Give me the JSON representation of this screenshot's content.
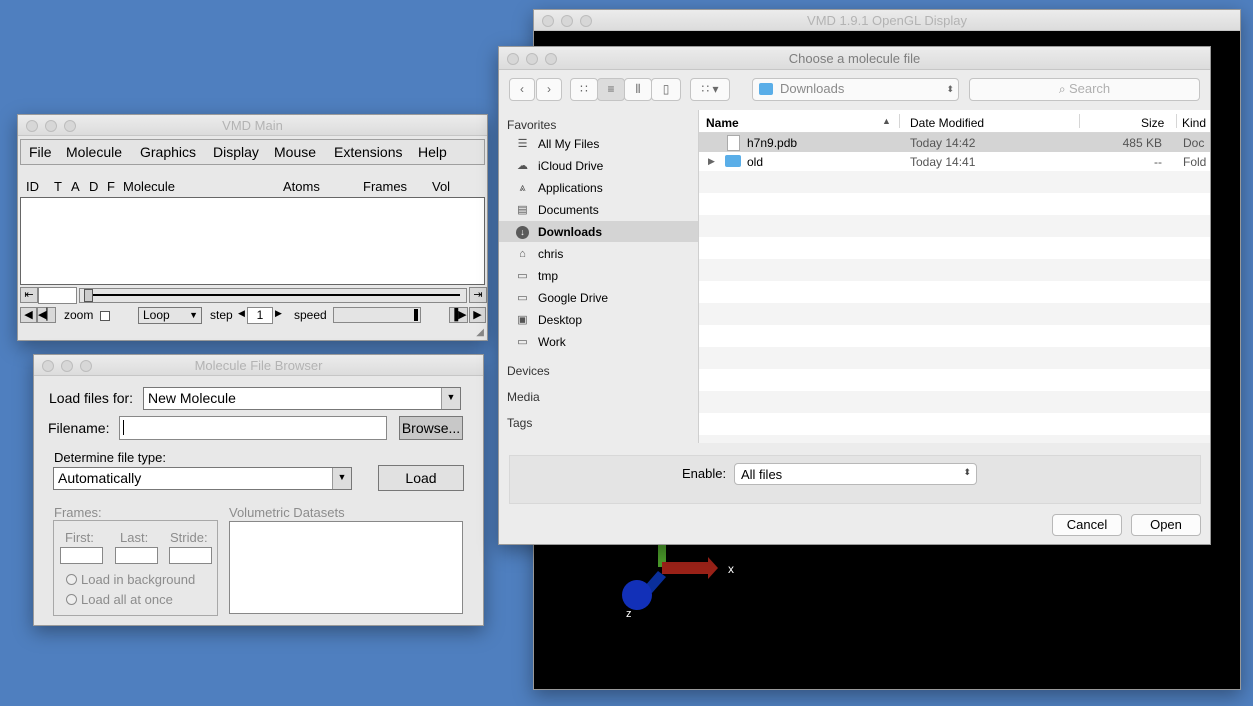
{
  "gl_window": {
    "title": "VMD 1.9.1 OpenGL Display",
    "axis_x": "x",
    "axis_z": "z"
  },
  "vmd_main": {
    "title": "VMD Main",
    "menus": [
      "File",
      "Molecule",
      "Graphics",
      "Display",
      "Mouse",
      "Extensions",
      "Help"
    ],
    "columns": [
      "ID",
      "T",
      "A",
      "D",
      "F",
      "Molecule",
      "Atoms",
      "Frames",
      "Vol"
    ],
    "zoom_label": "zoom",
    "loop_value": "Loop",
    "step_label": "step",
    "step_value": "1",
    "speed_label": "speed"
  },
  "file_browser": {
    "title": "Molecule File Browser",
    "load_for_label": "Load files for:",
    "load_for_value": "New Molecule",
    "filename_label": "Filename:",
    "filename_value": "",
    "browse_label": "Browse...",
    "filetype_label": "Determine file type:",
    "filetype_value": "Automatically",
    "load_label": "Load",
    "frames_label": "Frames:",
    "first_label": "First:",
    "last_label": "Last:",
    "stride_label": "Stride:",
    "load_bg_label": "Load in background",
    "load_all_label": "Load all at once",
    "volumetric_label": "Volumetric Datasets"
  },
  "chooser": {
    "title": "Choose a molecule file",
    "location": "Downloads",
    "search_placeholder": "Search",
    "sections": {
      "favorites": "Favorites",
      "devices": "Devices",
      "media": "Media",
      "tags": "Tags"
    },
    "favorites": [
      {
        "label": "All My Files",
        "icon": "all-files-icon"
      },
      {
        "label": "iCloud Drive",
        "icon": "cloud-icon"
      },
      {
        "label": "Applications",
        "icon": "applications-icon"
      },
      {
        "label": "Documents",
        "icon": "documents-icon"
      },
      {
        "label": "Downloads",
        "icon": "downloads-icon",
        "selected": true
      },
      {
        "label": "chris",
        "icon": "home-icon"
      },
      {
        "label": "tmp",
        "icon": "folder-icon"
      },
      {
        "label": "Google Drive",
        "icon": "folder-icon"
      },
      {
        "label": "Desktop",
        "icon": "desktop-icon"
      },
      {
        "label": "Work",
        "icon": "folder-icon"
      }
    ],
    "columns": {
      "name": "Name",
      "date": "Date Modified",
      "size": "Size",
      "kind": "Kind"
    },
    "files": [
      {
        "name": "h7n9.pdb",
        "date": "Today 14:42",
        "size": "485 KB",
        "kind": "Doc",
        "icon": "document-icon",
        "selected": true
      },
      {
        "name": "old",
        "date": "Today 14:41",
        "size": "--",
        "kind": "Fold",
        "icon": "folder-icon"
      }
    ],
    "enable_label": "Enable:",
    "enable_value": "All files",
    "cancel_label": "Cancel",
    "open_label": "Open",
    "colors": {
      "selection": "#d4d4d4",
      "folder_blue": "#5aaee8"
    }
  }
}
